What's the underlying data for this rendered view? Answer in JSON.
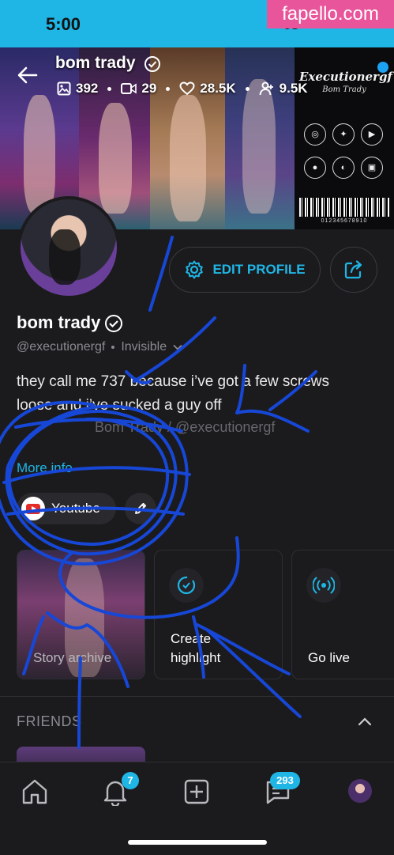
{
  "status_bar": {
    "time": "5:00",
    "signal": "5G"
  },
  "watermark": "fapello.com",
  "header": {
    "name": "bom trady",
    "stats": [
      {
        "icon": "photo-icon",
        "value": "392"
      },
      {
        "icon": "video-icon",
        "value": "29"
      },
      {
        "icon": "heart-icon",
        "value": "28.5K"
      },
      {
        "icon": "fans-icon",
        "value": "9.5K"
      }
    ]
  },
  "banner": {
    "brand_title": "Executionergf",
    "brand_subtitle": "Bom Trady",
    "barcode_number": "012345678910",
    "socials": [
      "instagram-icon",
      "twitter-icon",
      "youtube-icon",
      "reddit-icon",
      "discord-icon",
      "twitch-icon"
    ]
  },
  "actions": {
    "edit_profile": "EDIT PROFILE"
  },
  "profile": {
    "name": "bom trady",
    "handle": "@executionergf",
    "status": "Invisible",
    "bio_line1": "they call me 737 because i’ve got a few screws",
    "bio_line2": "loose and i’ve sucked a guy off",
    "bio_faded": "Bom Trady / @executionergf",
    "more_info": "More info"
  },
  "links": [
    {
      "label": "Youtube",
      "icon": "youtube-icon"
    }
  ],
  "cards": [
    {
      "label": "Story archive",
      "icon": "archive-icon"
    },
    {
      "label_line1": "Create",
      "label_line2": "highlight",
      "icon": "create-highlight-icon"
    },
    {
      "label": "Go live",
      "icon": "live-icon"
    }
  ],
  "friends": {
    "title": "FRIENDS"
  },
  "bottom_nav": {
    "notifications_badge": "7",
    "messages_badge": "293"
  },
  "colors": {
    "accent": "#1fb6e6",
    "background": "#1b1b1e",
    "scribble": "#1747d6"
  }
}
